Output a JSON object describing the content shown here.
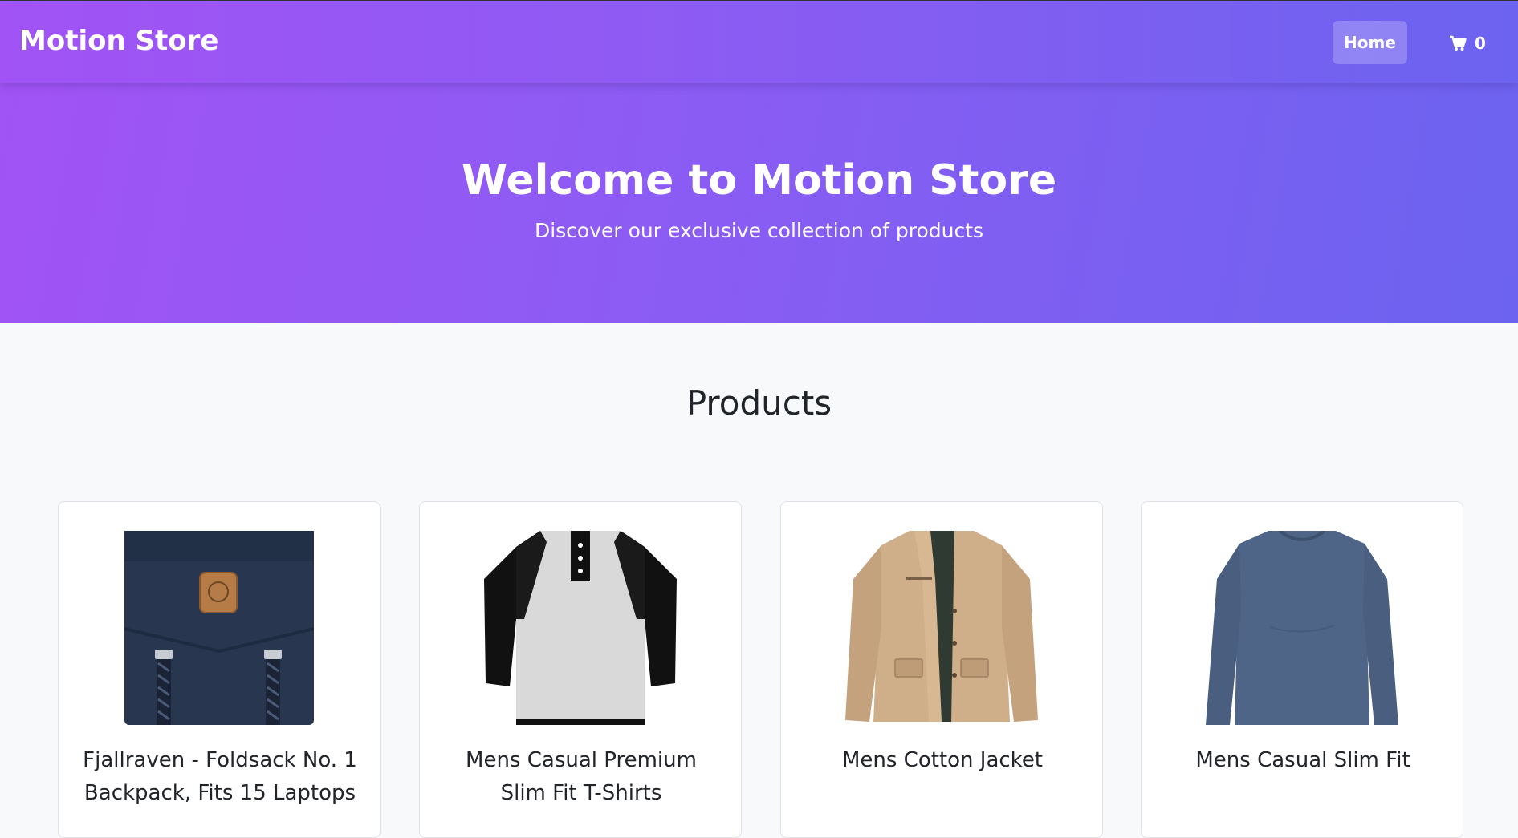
{
  "navbar": {
    "brand": "Motion Store",
    "home_label": "Home",
    "cart_count": "0",
    "cart_icon": "cart-icon"
  },
  "hero": {
    "title": "Welcome to Motion Store",
    "subtitle": "Discover our exclusive collection of products"
  },
  "products_section": {
    "title": "Products",
    "items": [
      {
        "title": "Fjallraven - Foldsack No. 1 Backpack, Fits 15 Laptops",
        "image": "backpack-image"
      },
      {
        "title": "Mens Casual Premium Slim Fit T-Shirts",
        "image": "tshirt-image"
      },
      {
        "title": "Mens Cotton Jacket",
        "image": "jacket-image"
      },
      {
        "title": "Mens Casual Slim Fit",
        "image": "longsleeve-image"
      }
    ]
  },
  "colors": {
    "gradient_start": "#a153f5",
    "gradient_end": "#6c63f0",
    "page_background": "#f8f9fb"
  }
}
